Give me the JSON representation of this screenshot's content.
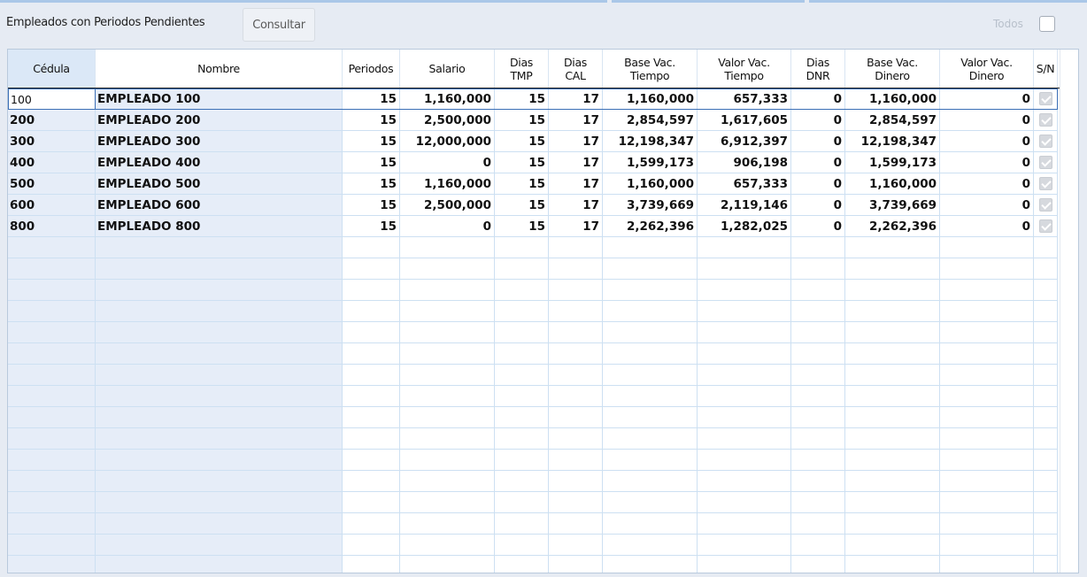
{
  "toolbar": {
    "title": "Empleados con Periodos Pendientes",
    "consultar_label": "Consultar",
    "todos_label": "Todos",
    "todos_checked": false
  },
  "grid": {
    "columns": [
      {
        "key": "cedula",
        "label": "Cédula"
      },
      {
        "key": "nombre",
        "label": "Nombre"
      },
      {
        "key": "periodos",
        "label": "Periodos"
      },
      {
        "key": "salario",
        "label": "Salario"
      },
      {
        "key": "dias_tmp",
        "label": "Dias\nTMP"
      },
      {
        "key": "dias_cal",
        "label": "Dias\nCAL"
      },
      {
        "key": "base_vac_tiempo",
        "label": "Base Vac.\nTiempo"
      },
      {
        "key": "valor_vac_tiempo",
        "label": "Valor Vac.\nTiempo"
      },
      {
        "key": "dias_dnr",
        "label": "Dias\nDNR"
      },
      {
        "key": "base_vac_dinero",
        "label": "Base Vac.\nDinero"
      },
      {
        "key": "valor_vac_dinero",
        "label": "Valor Vac.\nDinero"
      },
      {
        "key": "sn",
        "label": "S/N"
      }
    ],
    "rows": [
      {
        "cedula": "100",
        "nombre": "EMPLEADO 100",
        "periodos": "15",
        "salario": "1,160,000",
        "dias_tmp": "15",
        "dias_cal": "17",
        "base_vac_tiempo": "1,160,000",
        "valor_vac_tiempo": "657,333",
        "dias_dnr": "0",
        "base_vac_dinero": "1,160,000",
        "valor_vac_dinero": "0",
        "sn": true
      },
      {
        "cedula": "200",
        "nombre": "EMPLEADO 200",
        "periodos": "15",
        "salario": "2,500,000",
        "dias_tmp": "15",
        "dias_cal": "17",
        "base_vac_tiempo": "2,854,597",
        "valor_vac_tiempo": "1,617,605",
        "dias_dnr": "0",
        "base_vac_dinero": "2,854,597",
        "valor_vac_dinero": "0",
        "sn": true
      },
      {
        "cedula": "300",
        "nombre": "EMPLEADO 300",
        "periodos": "15",
        "salario": "12,000,000",
        "dias_tmp": "15",
        "dias_cal": "17",
        "base_vac_tiempo": "12,198,347",
        "valor_vac_tiempo": "6,912,397",
        "dias_dnr": "0",
        "base_vac_dinero": "12,198,347",
        "valor_vac_dinero": "0",
        "sn": true
      },
      {
        "cedula": "400",
        "nombre": "EMPLEADO 400",
        "periodos": "15",
        "salario": "0",
        "dias_tmp": "15",
        "dias_cal": "17",
        "base_vac_tiempo": "1,599,173",
        "valor_vac_tiempo": "906,198",
        "dias_dnr": "0",
        "base_vac_dinero": "1,599,173",
        "valor_vac_dinero": "0",
        "sn": true
      },
      {
        "cedula": "500",
        "nombre": "EMPLEADO 500",
        "periodos": "15",
        "salario": "1,160,000",
        "dias_tmp": "15",
        "dias_cal": "17",
        "base_vac_tiempo": "1,160,000",
        "valor_vac_tiempo": "657,333",
        "dias_dnr": "0",
        "base_vac_dinero": "1,160,000",
        "valor_vac_dinero": "0",
        "sn": true
      },
      {
        "cedula": "600",
        "nombre": "EMPLEADO 600",
        "periodos": "15",
        "salario": "2,500,000",
        "dias_tmp": "15",
        "dias_cal": "17",
        "base_vac_tiempo": "3,739,669",
        "valor_vac_tiempo": "2,119,146",
        "dias_dnr": "0",
        "base_vac_dinero": "3,739,669",
        "valor_vac_dinero": "0",
        "sn": true
      },
      {
        "cedula": "800",
        "nombre": "EMPLEADO 800",
        "periodos": "15",
        "salario": "0",
        "dias_tmp": "15",
        "dias_cal": "17",
        "base_vac_tiempo": "2,262,396",
        "valor_vac_tiempo": "1,282,025",
        "dias_dnr": "0",
        "base_vac_dinero": "2,262,396",
        "valor_vac_dinero": "0",
        "sn": true
      }
    ],
    "selected_row": 0
  }
}
